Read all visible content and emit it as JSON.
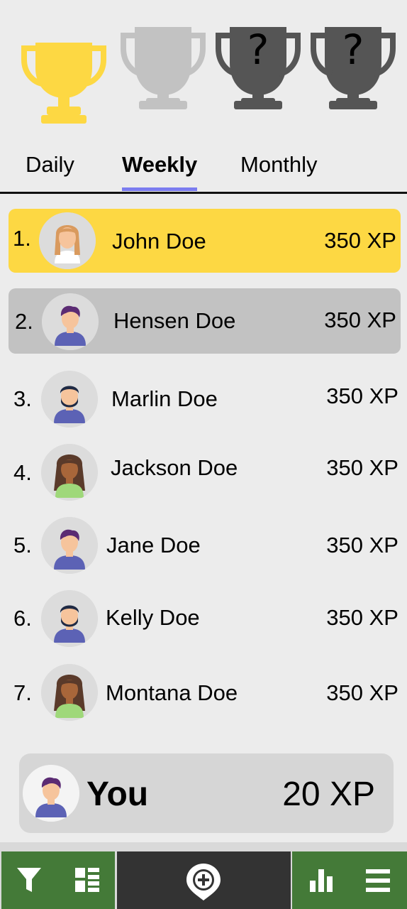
{
  "trophies": [
    {
      "icon": "trophy-gold-icon",
      "color": "#fdd843",
      "mark": ""
    },
    {
      "icon": "trophy-silver-icon",
      "color": "#c2c2c2",
      "mark": ""
    },
    {
      "icon": "trophy-locked-icon",
      "color": "#555555",
      "mark": "?"
    },
    {
      "icon": "trophy-locked-icon",
      "color": "#555555",
      "mark": "?"
    }
  ],
  "tabs": [
    {
      "label": "Daily",
      "active": false
    },
    {
      "label": "Weekly",
      "active": true
    },
    {
      "label": "Monthly",
      "active": false
    }
  ],
  "leaderboard": [
    {
      "rank": "1.",
      "name": "John Doe",
      "xp": "350 XP",
      "avatar": "woman-blonde-avatar",
      "highlight": "#fdd843"
    },
    {
      "rank": "2.",
      "name": "Hensen Doe",
      "xp": "350 XP",
      "avatar": "man-purple-hair-avatar",
      "highlight": "#c2c2c2"
    },
    {
      "rank": "3.",
      "name": "Marlin Doe",
      "xp": "350 XP",
      "avatar": "man-beard-avatar",
      "highlight": ""
    },
    {
      "rank": "4.",
      "name": "Jackson Doe",
      "xp": "350 XP",
      "avatar": "woman-curly-hair-avatar",
      "highlight": ""
    },
    {
      "rank": "5.",
      "name": "Jane Doe",
      "xp": "350 XP",
      "avatar": "man-purple-hair-avatar",
      "highlight": ""
    },
    {
      "rank": "6.",
      "name": "Kelly Doe",
      "xp": "350 XP",
      "avatar": "man-beard-avatar",
      "highlight": ""
    },
    {
      "rank": "7.",
      "name": "Montana Doe",
      "xp": "350 XP",
      "avatar": "woman-curly-hair-avatar",
      "highlight": ""
    }
  ],
  "you": {
    "label": "You",
    "xp": "20 XP",
    "avatar": "man-purple-hair-avatar"
  },
  "bottom_nav": {
    "left_color": "#447a38",
    "middle_color": "#333333",
    "icons": [
      "filter-icon",
      "list-view-icon",
      "add-location-icon",
      "bar-chart-icon",
      "menu-icon"
    ]
  }
}
